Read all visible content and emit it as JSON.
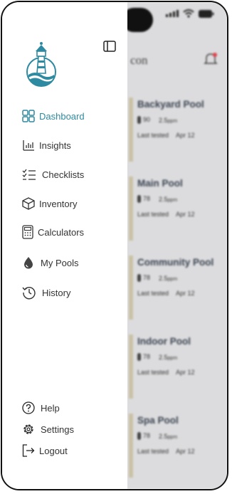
{
  "drawer": {
    "nav": [
      {
        "label": "Dashboard",
        "icon": "grid-icon",
        "active": true
      },
      {
        "label": "Insights",
        "icon": "bar-chart-icon"
      },
      {
        "label": "Checklists",
        "icon": "checklist-icon"
      },
      {
        "label": "Inventory",
        "icon": "box-icon"
      },
      {
        "label": "Calculators",
        "icon": "calculator-icon"
      },
      {
        "label": "My Pools",
        "icon": "water-drop-icon"
      },
      {
        "label": "History",
        "icon": "history-icon"
      }
    ],
    "footer": [
      {
        "label": "Help",
        "icon": "help-icon"
      },
      {
        "label": "Settings",
        "icon": "gear-icon"
      },
      {
        "label": "Logout",
        "icon": "logout-icon"
      }
    ]
  },
  "background": {
    "title_fragment": "con",
    "pools": [
      {
        "name": "Backyard Pool",
        "temp": "90",
        "chlorine": "2.5",
        "unit": "ppm",
        "last_label": "Last tested",
        "last_date": "Apr 12"
      },
      {
        "name": "Main Pool",
        "temp": "78",
        "chlorine": "2.5",
        "unit": "ppm",
        "last_label": "Last tested",
        "last_date": "Apr 12"
      },
      {
        "name": "Community Pool",
        "temp": "78",
        "chlorine": "2.5",
        "unit": "ppm",
        "last_label": "Last tested",
        "last_date": "Apr 12"
      },
      {
        "name": "Indoor Pool",
        "temp": "78",
        "chlorine": "2.5",
        "unit": "ppm",
        "last_label": "Last tested",
        "last_date": "Apr 12"
      },
      {
        "name": "Spa Pool",
        "temp": "78",
        "chlorine": "2.5",
        "unit": "ppm",
        "last_label": "Last tested",
        "last_date": "Apr 12"
      }
    ]
  },
  "colors": {
    "accent": "#2e8aa0",
    "text": "#333333",
    "notification": "#e0404a"
  }
}
